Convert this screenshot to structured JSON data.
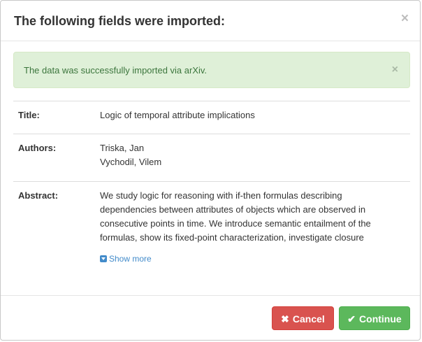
{
  "header": {
    "title": "The following fields were imported:",
    "close_glyph": "×"
  },
  "alert": {
    "message": "The data was successfully imported via arXiv.",
    "close_glyph": "×",
    "color": "#3c763d",
    "background": "#dff0d8"
  },
  "fields": [
    {
      "label": "Title:",
      "value": "Logic of temporal attribute implications"
    },
    {
      "label": "Authors:",
      "values": [
        "Triska, Jan",
        "Vychodil, Vilem"
      ]
    },
    {
      "label": "Abstract:",
      "value": "We study logic for reasoning with if-then formulas describing dependencies between attributes of objects which are observed in consecutive points in time. We introduce semantic entailment of the formulas, show its fixed-point characterization, investigate closure"
    }
  ],
  "show_more": {
    "label": "Show more",
    "icon": "caret-down-square-icon"
  },
  "footer": {
    "cancel": {
      "icon": "✖",
      "label": "Cancel",
      "color": "#d9534f"
    },
    "continue": {
      "icon": "✔",
      "label": "Continue",
      "color": "#5cb85c"
    }
  }
}
